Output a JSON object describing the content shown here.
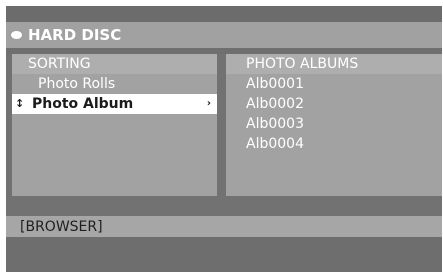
{
  "header": {
    "title": "HARD DISC",
    "icon": "disc-icon"
  },
  "left_panel": {
    "heading": "SORTING",
    "items": [
      {
        "label": "Photo Rolls",
        "selected": false
      },
      {
        "label": "Photo Album",
        "selected": true
      }
    ]
  },
  "right_panel": {
    "heading": "PHOTO ALBUMS",
    "items": [
      "Alb0001",
      "Alb0002",
      "Alb0003",
      "Alb0004"
    ]
  },
  "status": {
    "text": "[BROWSER]"
  },
  "colors": {
    "background": "#727272",
    "panel": "#a2a2a2",
    "header_row": "#aeaeae",
    "highlight": "#ffffff",
    "text": "#ffffff",
    "selected_text": "#1b1b1b"
  }
}
